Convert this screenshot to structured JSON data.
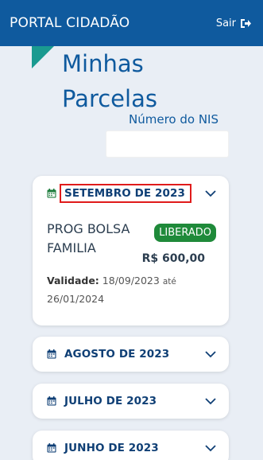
{
  "header": {
    "brand": "PORTAL CIDADÃO",
    "logout_label": "Sair"
  },
  "page": {
    "title_line1": "Minhas",
    "title_line2": "Parcelas",
    "nis_label": "Número do NIS",
    "nis_value": ""
  },
  "installments": [
    {
      "month": "SETEMBRO DE 2023",
      "expanded": true,
      "program": "PROG BOLSA FAMILIA",
      "status": "LIBERADO",
      "status_color": "#1f8a3a",
      "amount": "R$ 600,00",
      "validity_label": "Validade:",
      "validity_start": "18/09/2023",
      "validity_sep": "até",
      "validity_end": "26/01/2024"
    },
    {
      "month": "AGOSTO DE 2023",
      "expanded": false
    },
    {
      "month": "JULHO DE 2023",
      "expanded": false
    },
    {
      "month": "JUNHO DE 2023",
      "expanded": false
    }
  ],
  "icons": {
    "logout": "sign-out-icon",
    "calendar": "calendar-icon",
    "chevron": "chevron-down-icon"
  },
  "colors": {
    "primary": "#0f5a9e",
    "accent": "#1a9a90",
    "highlight_border": "#e01b1b",
    "background": "#e9eef5"
  }
}
